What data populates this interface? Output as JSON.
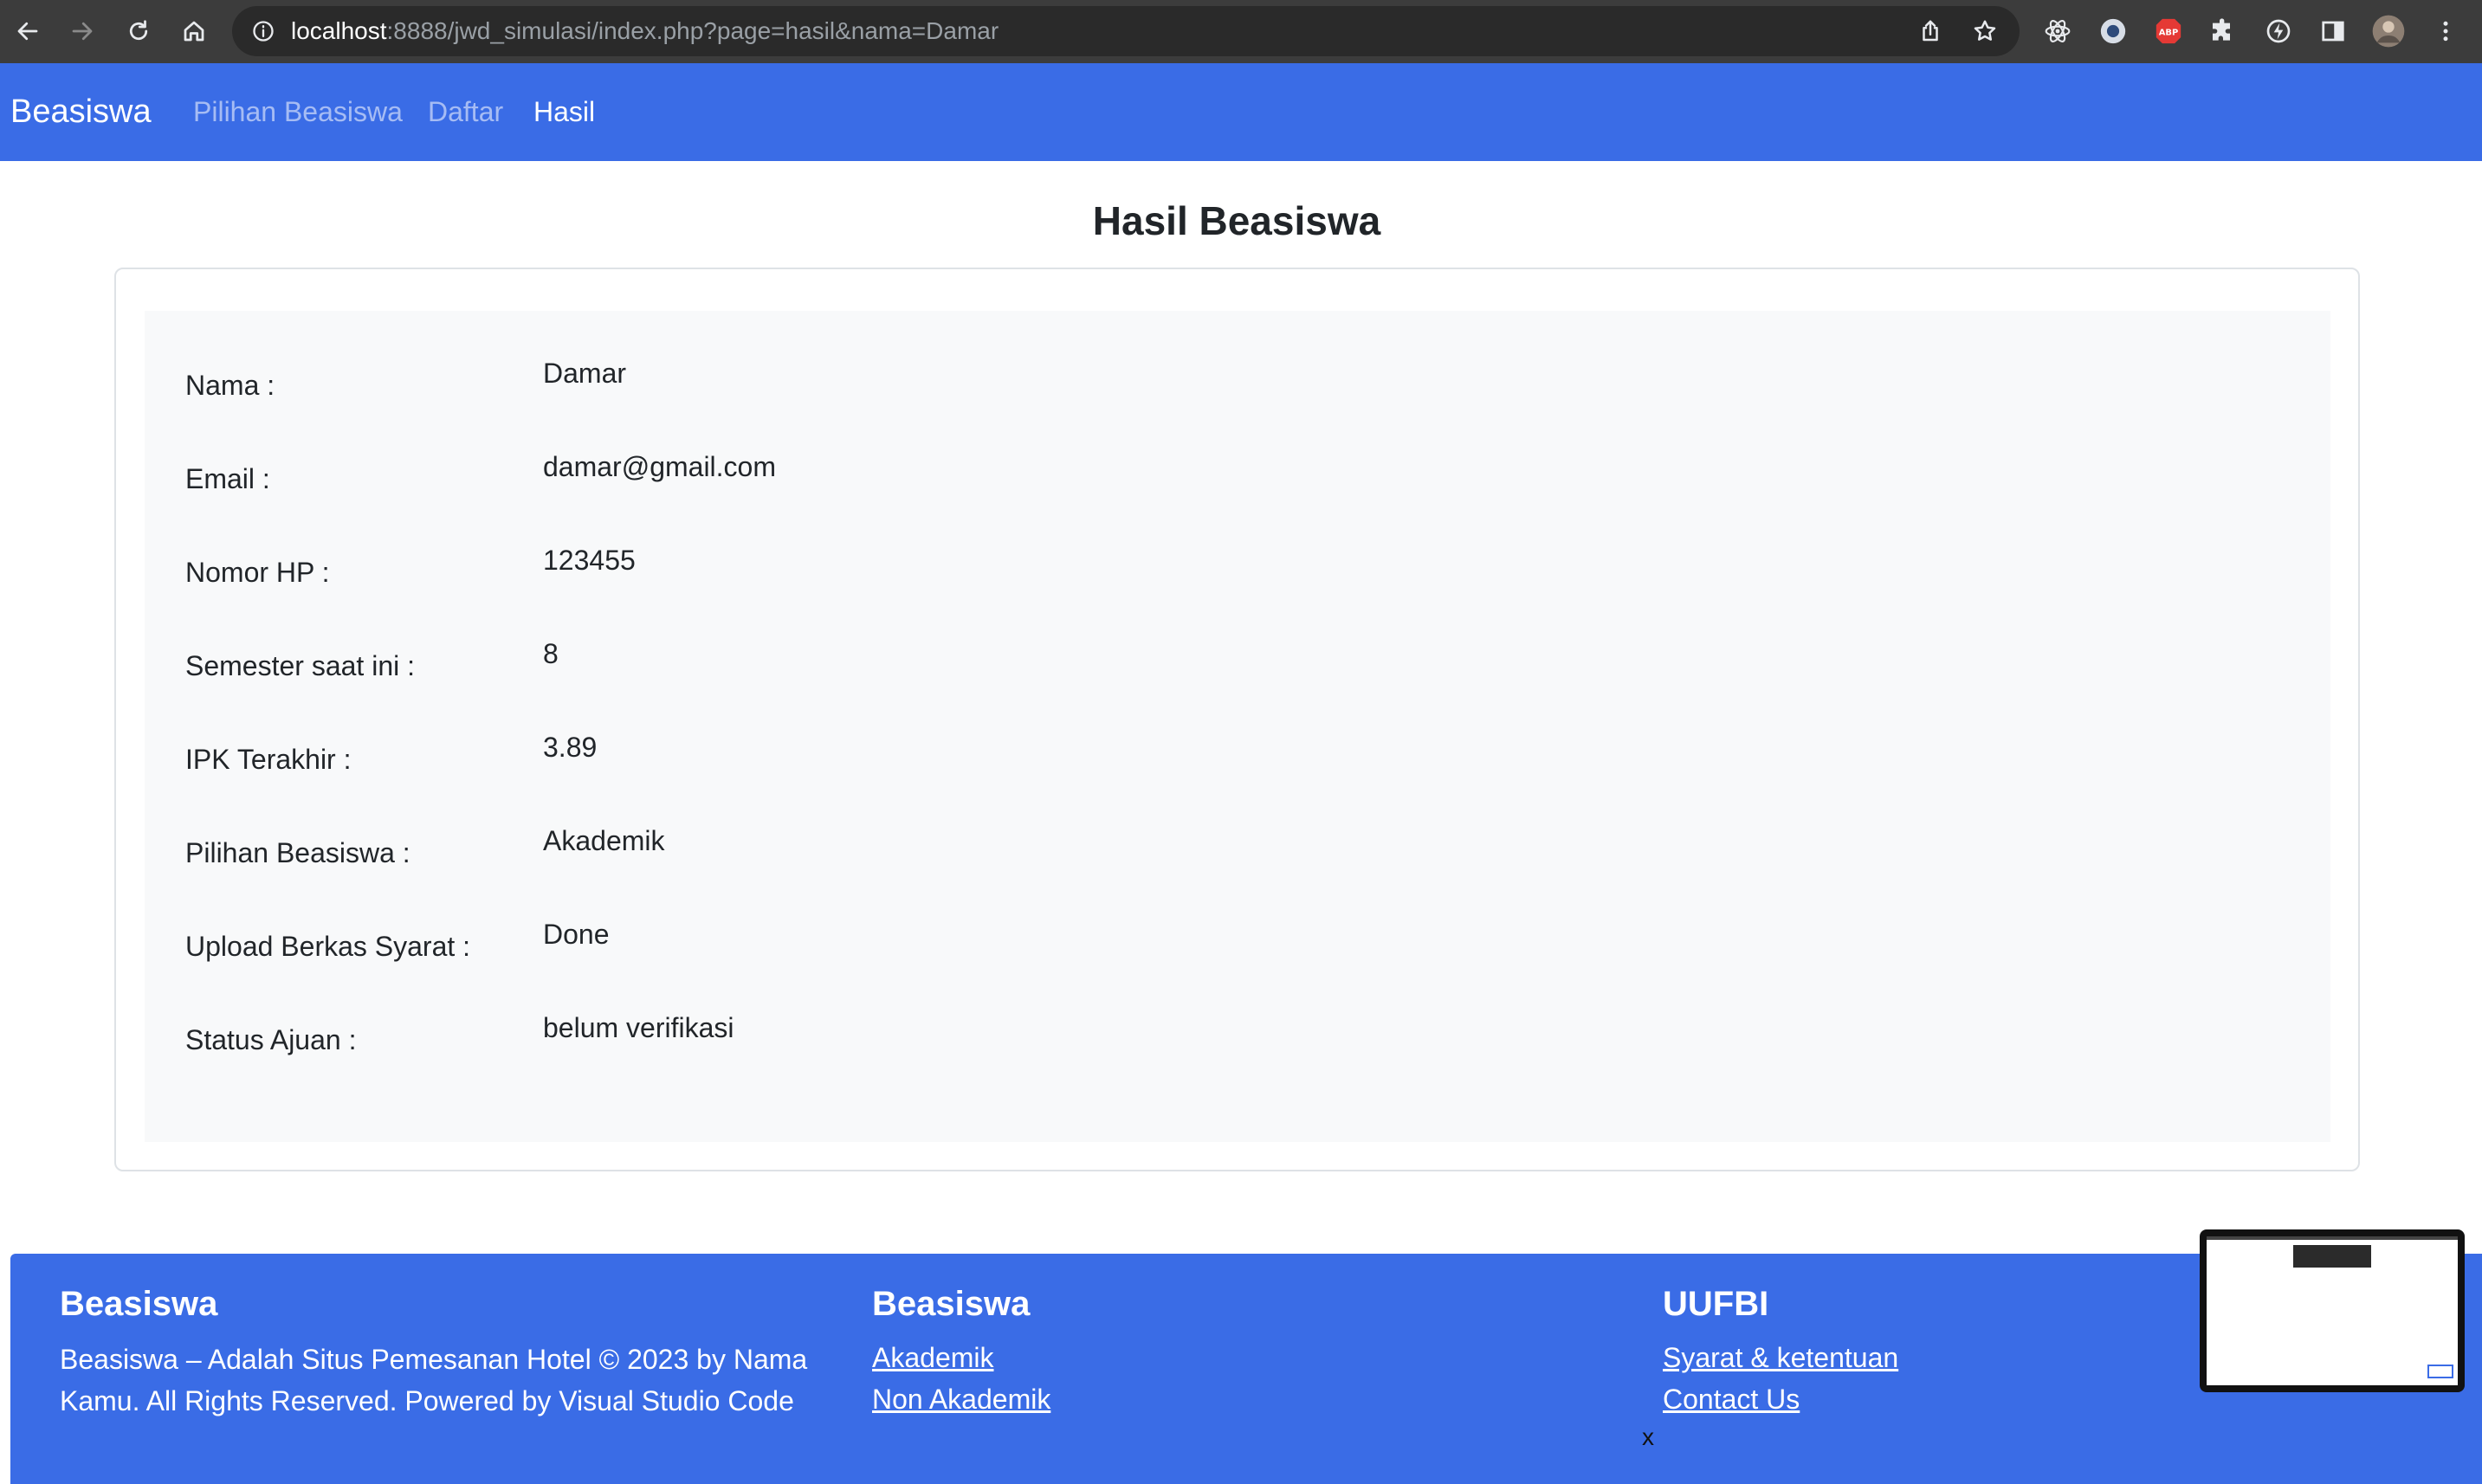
{
  "browser": {
    "url_host": "localhost",
    "url_path": ":8888/jwd_simulasi/index.php?page=hasil&nama=Damar"
  },
  "navbar": {
    "brand": "Beasiswa",
    "links": [
      {
        "label": "Pilihan Beasiswa",
        "active": false
      },
      {
        "label": "Daftar",
        "active": false
      },
      {
        "label": "Hasil",
        "active": true
      }
    ]
  },
  "main": {
    "title": "Hasil Beasiswa",
    "rows": [
      {
        "label": "Nama :",
        "value": "Damar"
      },
      {
        "label": "Email :",
        "value": "damar@gmail.com"
      },
      {
        "label": "Nomor HP :",
        "value": "123455"
      },
      {
        "label": "Semester saat ini :",
        "value": "8"
      },
      {
        "label": "IPK Terakhir :",
        "value": "3.89"
      },
      {
        "label": "Pilihan Beasiswa :",
        "value": "Akademik"
      },
      {
        "label": "Upload Berkas Syarat :",
        "value": "Done"
      },
      {
        "label": "Status Ajuan :",
        "value": "belum verifikasi"
      }
    ]
  },
  "footer": {
    "col1": {
      "title": "Beasiswa",
      "text": "Beasiswa – Adalah Situs Pemesanan Hotel © 2023 by Nama Kamu. All Rights Reserved. Powered by Visual Studio Code"
    },
    "col2": {
      "title": "Beasiswa",
      "links": [
        "Akademik",
        "Non Akademik"
      ]
    },
    "col3": {
      "title": "UUFBI",
      "links": [
        "Syarat & ketentuan",
        "Contact Us"
      ]
    },
    "close_label": "x"
  },
  "colors": {
    "primary": "#3a6ce6",
    "browser_bar": "#3c3c3c",
    "card_bg": "#f8f9fa",
    "abp_red": "#e53935"
  },
  "icons": [
    "back-icon",
    "forward-icon",
    "reload-icon",
    "home-icon",
    "info-icon",
    "share-icon",
    "star-icon",
    "react-devtools-icon",
    "circle-extension-icon",
    "adblock-icon",
    "puzzle-icon",
    "lightning-icon",
    "sidepanel-icon",
    "avatar",
    "kebab-menu-icon"
  ]
}
